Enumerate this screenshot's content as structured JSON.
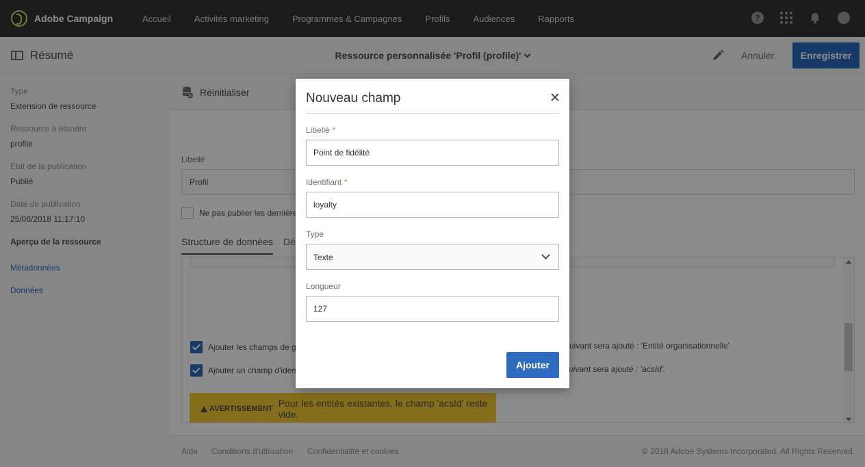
{
  "app": {
    "name": "Adobe Campaign"
  },
  "nav": {
    "items": [
      {
        "label": "Accueil"
      },
      {
        "label": "Activités marketing"
      },
      {
        "label": "Programmes & Campagnes"
      },
      {
        "label": "Profils"
      },
      {
        "label": "Audiences"
      },
      {
        "label": "Rapports"
      }
    ],
    "help_glyph": "?"
  },
  "header": {
    "summary_label": "Résumé",
    "title": "Ressource personnalisée 'Profil (profile)'",
    "cancel_label": "Annuler",
    "save_label": "Enregistrer"
  },
  "sidebar": {
    "type_label": "Type",
    "type_value": "Extension de ressource",
    "resource_label": "Ressource à étendre",
    "resource_value": "profile",
    "state_label": "Etat de la publication",
    "state_value": "Publié",
    "date_label": "Date de publication",
    "date_value": "25/06/2018 11:17:10",
    "overview_heading": "Aperçu de la ressource",
    "links": [
      {
        "label": "Métadonnées"
      },
      {
        "label": "Données"
      }
    ]
  },
  "main": {
    "reset_label": "Réinitialiser",
    "libelle_label": "Libellé",
    "libelle_value": "Profil",
    "no_publish_label": "Ne pas publier les dernière",
    "tabs": [
      {
        "label": "Structure de données",
        "active": true
      },
      {
        "label": "Déf",
        "active": false
      }
    ],
    "option1_label": "Ajouter les champs de ge",
    "option1_note": "suivant sera ajouté : 'Entité organisationnelle'",
    "option2_label": "Ajouter un champ d'iden",
    "option2_note": "uivant sera ajouté : 'acsId'.",
    "warning_title": "AVERTISSEMENT",
    "warning_text": "Pour les entités existantes, le champ 'acsId' reste vide."
  },
  "footer": {
    "links": [
      {
        "label": "Aide"
      },
      {
        "label": "Conditions d'utilisation"
      },
      {
        "label": "Confidentialité et cookies"
      }
    ],
    "copyright": "© 2018 Adobe Systems Incorporated. All Rights Reserved."
  },
  "dialog": {
    "title": "Nouveau champ",
    "required_mark": "*",
    "libelle_label": "Libellé",
    "libelle_value": "Point de fidélité",
    "identifiant_label": "Identifiant",
    "identifiant_value": "loyalty",
    "type_label": "Type",
    "type_value": "Texte",
    "longueur_label": "Longueur",
    "longueur_value": "127",
    "add_label": "Ajouter"
  },
  "colors": {
    "topbar": "#323232",
    "accent": "#2d6bbf",
    "warning": "#f3c932",
    "logo": "#d4e157"
  }
}
